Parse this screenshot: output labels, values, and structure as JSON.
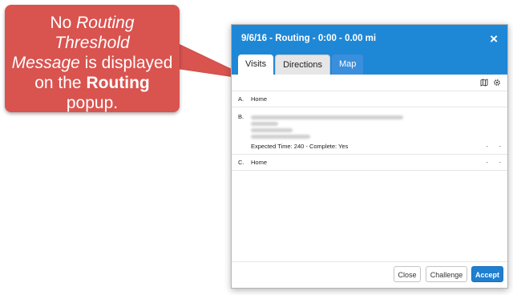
{
  "callout": {
    "line1": "No ",
    "line1_em": "Routing Threshold",
    "line2_em": "Message",
    "line2": " is displayed",
    "line3": "on the ",
    "line3_bold": "Routing",
    "line4": "popup."
  },
  "dialog": {
    "title": "9/6/16 - Routing - 0:00 - 0.00 mi",
    "close_icon": "×",
    "tabs": [
      {
        "label": "Visits"
      },
      {
        "label": "Directions"
      },
      {
        "label": "Map"
      }
    ],
    "toolbar": {
      "map_icon": "map-icon",
      "gear_icon": "gear-icon"
    },
    "stops": [
      {
        "letter": "A.",
        "name": "Home"
      },
      {
        "letter": "B.",
        "detail": "Expected Time: 240 - Complete: Yes",
        "dash1": "-",
        "dash2": "-"
      },
      {
        "letter": "C.",
        "name": "Home",
        "dash1": "-",
        "dash2": "-"
      }
    ],
    "buttons": {
      "close": "Close",
      "challenge": "Challenge",
      "accept": "Accept"
    }
  },
  "colors": {
    "accent": "#1f88d6",
    "callout": "#d9534f"
  }
}
